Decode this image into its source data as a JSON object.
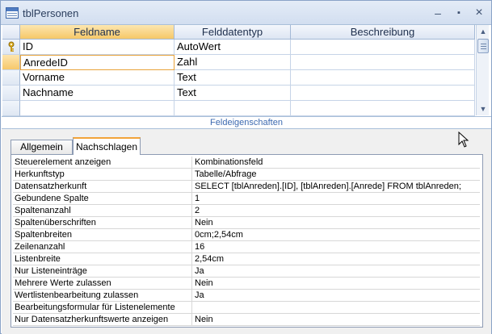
{
  "window": {
    "title": "tblPersonen",
    "buttons": {
      "minimize": "–",
      "maximize": "▪",
      "close": "×"
    }
  },
  "grid": {
    "columns": [
      "Feldname",
      "Felddatentyp",
      "Beschreibung"
    ],
    "rows": [
      {
        "name": "ID",
        "type": "AutoWert",
        "description": "",
        "primary_key": true
      },
      {
        "name": "AnredeID",
        "type": "Zahl",
        "description": "",
        "selected": true
      },
      {
        "name": "Vorname",
        "type": "Text",
        "description": ""
      },
      {
        "name": "Nachname",
        "type": "Text",
        "description": ""
      }
    ]
  },
  "properties_label": "Feldeigenschaften",
  "tabs": [
    {
      "label": "Allgemein",
      "active": false
    },
    {
      "label": "Nachschlagen",
      "active": true
    }
  ],
  "properties": [
    {
      "key": "Steuerelement anzeigen",
      "value": "Kombinationsfeld"
    },
    {
      "key": "Herkunftstyp",
      "value": "Tabelle/Abfrage"
    },
    {
      "key": "Datensatzherkunft",
      "value": "SELECT [tblAnreden].[ID], [tblAnreden].[Anrede] FROM tblAnreden;"
    },
    {
      "key": "Gebundene Spalte",
      "value": "1"
    },
    {
      "key": "Spaltenanzahl",
      "value": "2"
    },
    {
      "key": "Spaltenüberschriften",
      "value": "Nein"
    },
    {
      "key": "Spaltenbreiten",
      "value": "0cm;2,54cm"
    },
    {
      "key": "Zeilenanzahl",
      "value": "16"
    },
    {
      "key": "Listenbreite",
      "value": "2,54cm"
    },
    {
      "key": "Nur Listeneinträge",
      "value": "Ja"
    },
    {
      "key": "Mehrere Werte zulassen",
      "value": "Nein"
    },
    {
      "key": "Wertlistenbearbeitung zulassen",
      "value": "Ja"
    },
    {
      "key": "Bearbeitungsformular für Listenelemente",
      "value": ""
    },
    {
      "key": "Nur Datensatzherkunftswerte anzeigen",
      "value": "Nein"
    }
  ],
  "colors": {
    "accent": "#f6c868",
    "title_bar": "#d2def0",
    "label_blue": "#3d6ab0"
  },
  "icons": {
    "table": "table-icon",
    "primary_key": "key-icon",
    "cursor": "mouse-pointer-icon"
  }
}
